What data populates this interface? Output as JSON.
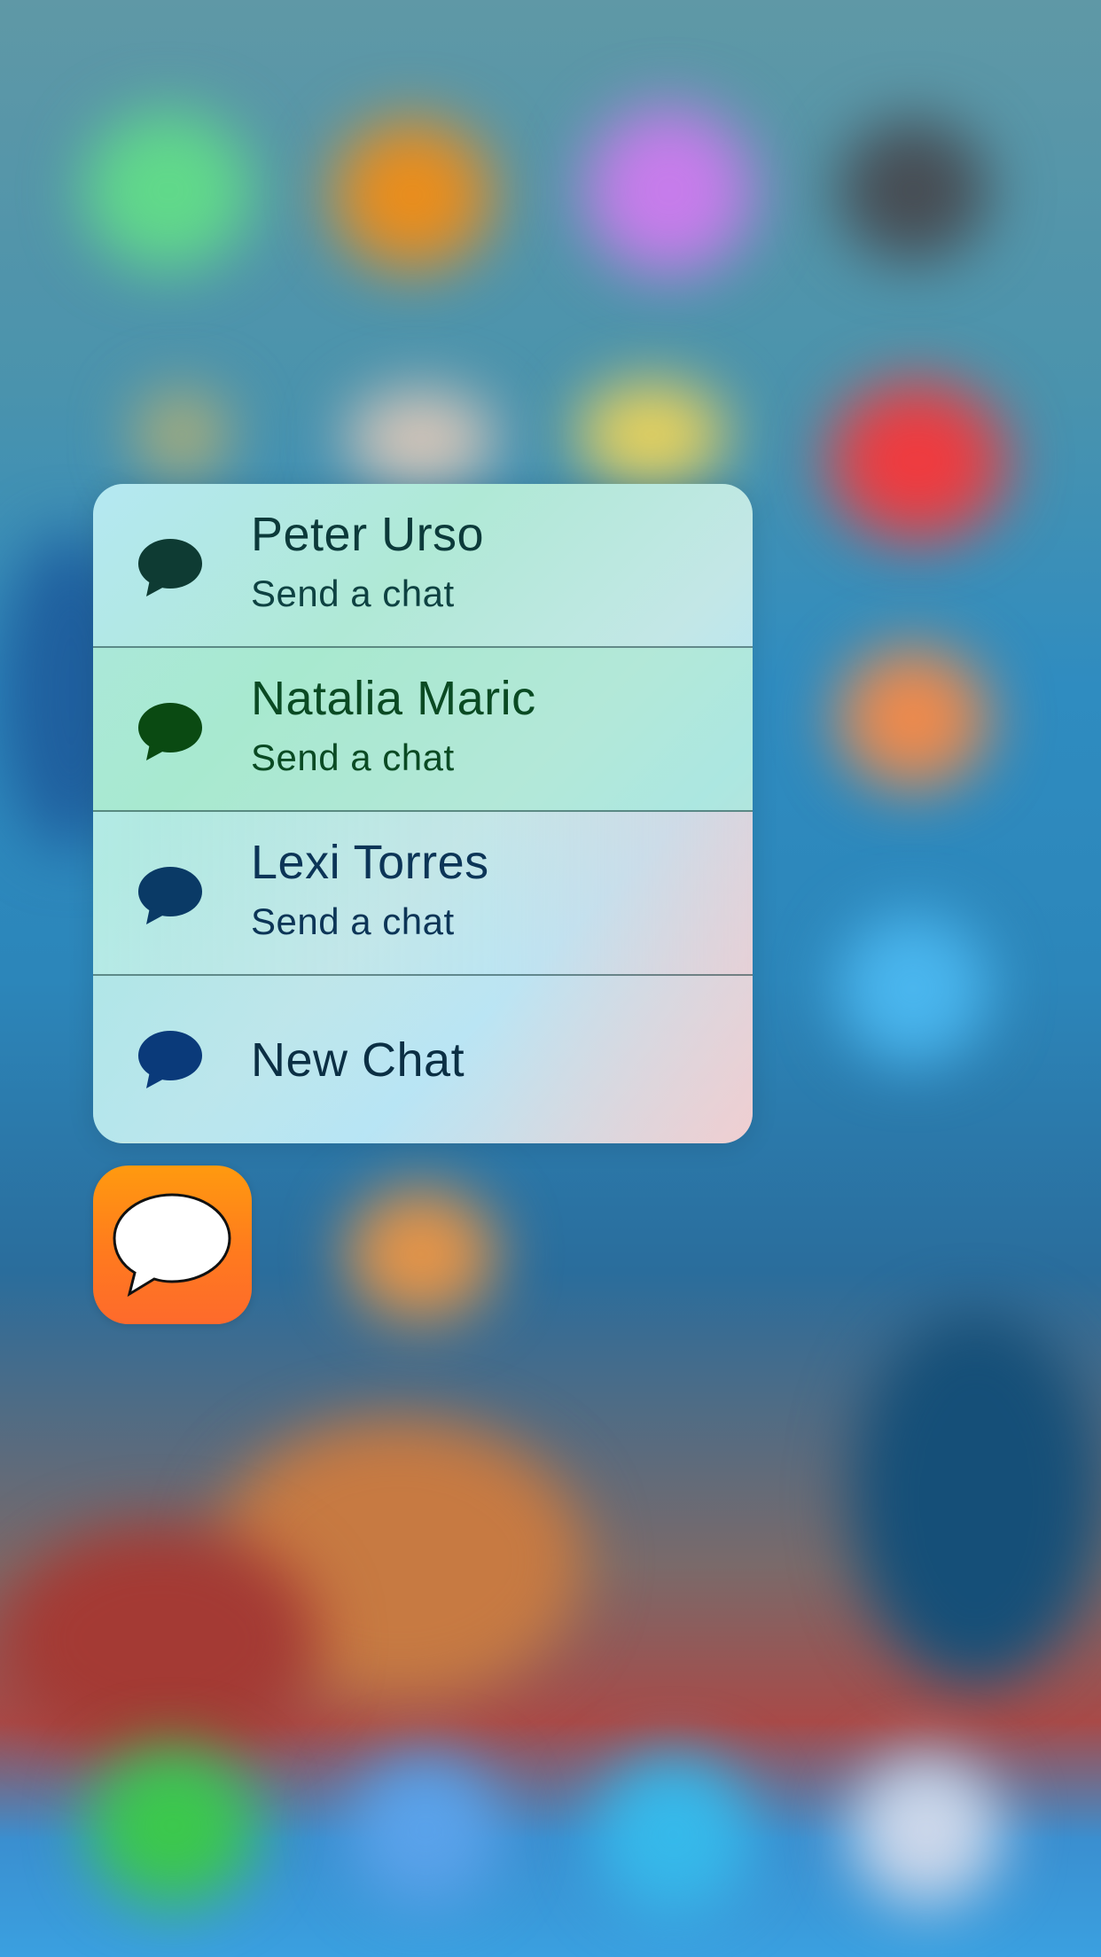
{
  "menu": {
    "items": [
      {
        "title": "Peter Urso",
        "subtitle": "Send a chat",
        "icon": "speech-bubble-icon",
        "icon_color": "#0e3b33"
      },
      {
        "title": "Natalia Maric",
        "subtitle": "Send a chat",
        "icon": "speech-bubble-icon",
        "icon_color": "#0a4a12"
      },
      {
        "title": "Lexi Torres",
        "subtitle": "Send a chat",
        "icon": "speech-bubble-icon",
        "icon_color": "#0a3a66"
      },
      {
        "title": "New Chat",
        "icon": "speech-bubble-icon",
        "icon_color": "#0a3a7a"
      }
    ]
  },
  "app_icon": {
    "icon": "chat-bubble-icon",
    "colors": [
      "#ff9a0f",
      "#fe6a2c"
    ]
  }
}
